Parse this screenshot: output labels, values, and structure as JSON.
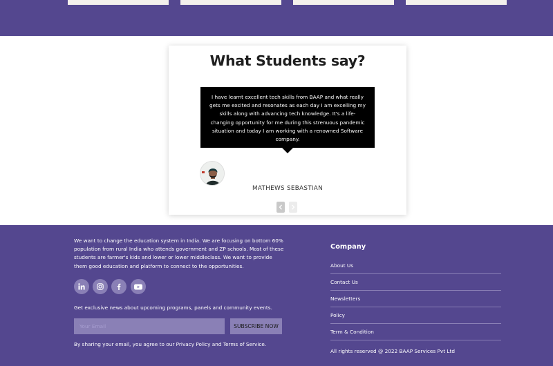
{
  "colors": {
    "brand_purple": "#54478f",
    "social_bg": "#8a80b6",
    "quote_bg": "#000000"
  },
  "testimonials": {
    "title": "What Students say?",
    "quote": "I have learnt excellent tech skills from BAAP and what really gets me excited and resonates as each day I am excelling my skills along with advancing tech knowledge. It's a life-changing opportunity for me during this strenuous pandemic situation and today I am working with a renowned Software company.",
    "student_name": "MATHEWS SEBASTIAN",
    "prev_icon": "chevron-left-icon",
    "next_icon": "chevron-right-icon"
  },
  "footer": {
    "about": "We want to change the education system in India. We are focusing on bottom 60% population from rural India who attends government and ZP schools. Most of these students are farmer's kids and lower or lower middleclass. We want to provide them good education and platform to connect to the opportunities.",
    "social_icons": [
      "linkedin-icon",
      "instagram-icon",
      "facebook-icon",
      "youtube-icon"
    ],
    "newsletter_text": "Get exclusive news about upcoming programs, panels and community events.",
    "email_placeholder": "Your Email",
    "subscribe_label": "SUBSCRIBE NOW",
    "consent": "By sharing your email, you agree to our Privacy Policy and Terms of Service.",
    "company": {
      "heading": "Company",
      "links": [
        "About Us",
        "Contact Us",
        "Newsletters",
        "Policy",
        "Term & Condition"
      ]
    },
    "copyright": "All rights reserved @ 2022 BAAP Services Pvt Ltd"
  }
}
